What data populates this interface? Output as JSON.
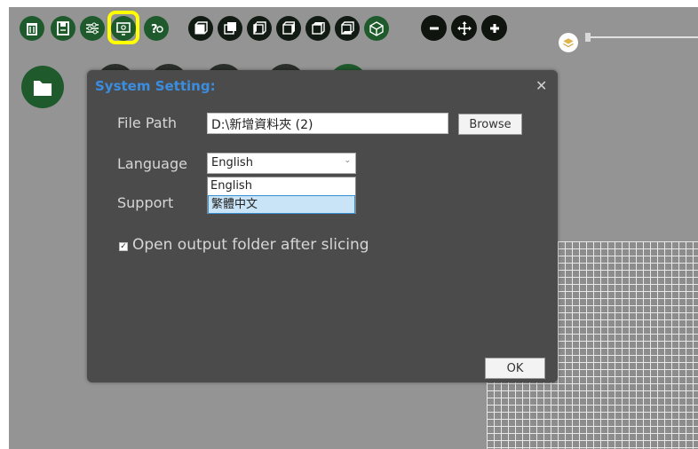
{
  "toolbar": {
    "buttons": [
      {
        "name": "trash-icon"
      },
      {
        "name": "save-icon"
      },
      {
        "name": "sliders-icon"
      },
      {
        "name": "settings-monitor-icon",
        "highlighted": true
      },
      {
        "name": "help-icon"
      },
      {
        "name": "view-front-icon"
      },
      {
        "name": "view-back-icon"
      },
      {
        "name": "view-left-icon"
      },
      {
        "name": "view-right-icon"
      },
      {
        "name": "view-top-icon"
      },
      {
        "name": "view-bottom-icon"
      },
      {
        "name": "view-iso-icon"
      },
      {
        "name": "zoom-out-icon"
      },
      {
        "name": "move-icon"
      },
      {
        "name": "zoom-in-icon"
      }
    ],
    "highlight_color": "#ffff00"
  },
  "dialog": {
    "title": "System Setting:",
    "close_glyph": "✕",
    "file_path_label": "File Path",
    "file_path_value": "D:\\新增資料夾 (2)",
    "browse_label": "Browse",
    "language_label": "Language",
    "language_selected": "English",
    "language_options": [
      "English",
      "繁體中文"
    ],
    "support_label": "Support",
    "open_folder_checked": true,
    "open_folder_label": "Open output folder after slicing",
    "ok_label": "OK"
  },
  "colors": {
    "toolbar_green": "#1f5a2c",
    "dialog_bg": "#4b4b4b",
    "title_blue": "#3b8de0",
    "workspace_bg": "#949494"
  }
}
